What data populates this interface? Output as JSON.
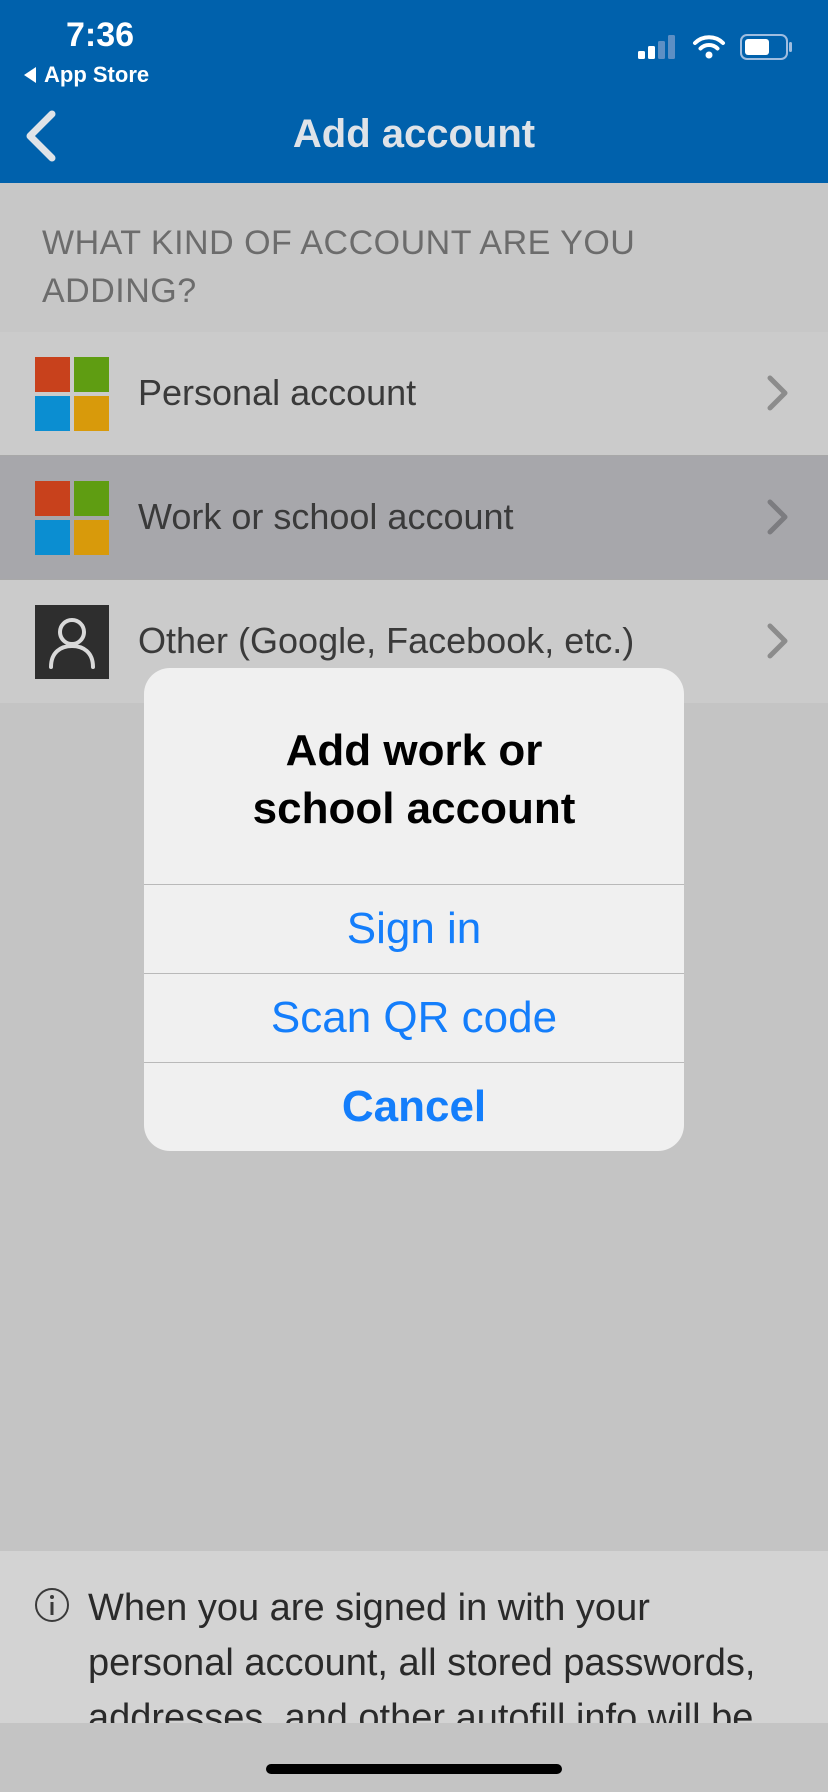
{
  "status_bar": {
    "time": "7:36",
    "back_app": "App Store"
  },
  "nav": {
    "title": "Add account"
  },
  "section": {
    "header": "WHAT KIND OF ACCOUNT ARE YOU ADDING?"
  },
  "accounts": [
    {
      "label": "Personal account",
      "icon": "microsoft-logo"
    },
    {
      "label": "Work or school account",
      "icon": "microsoft-logo",
      "selected": true
    },
    {
      "label": "Other (Google, Facebook, etc.)",
      "icon": "person-icon"
    }
  ],
  "dialog": {
    "title": "Add work or school account",
    "sign_in": "Sign in",
    "scan_qr": "Scan QR code",
    "cancel": "Cancel"
  },
  "info": {
    "text": "When you are signed in with your personal account, all stored passwords, addresses, and other autofill info will be"
  },
  "colors": {
    "nav_bar": "#0061ac",
    "dialog_button": "#147efb",
    "ms_red": "#c8411c",
    "ms_green": "#5f9d12",
    "ms_blue": "#0b8ed1",
    "ms_yellow": "#d89a0b"
  }
}
